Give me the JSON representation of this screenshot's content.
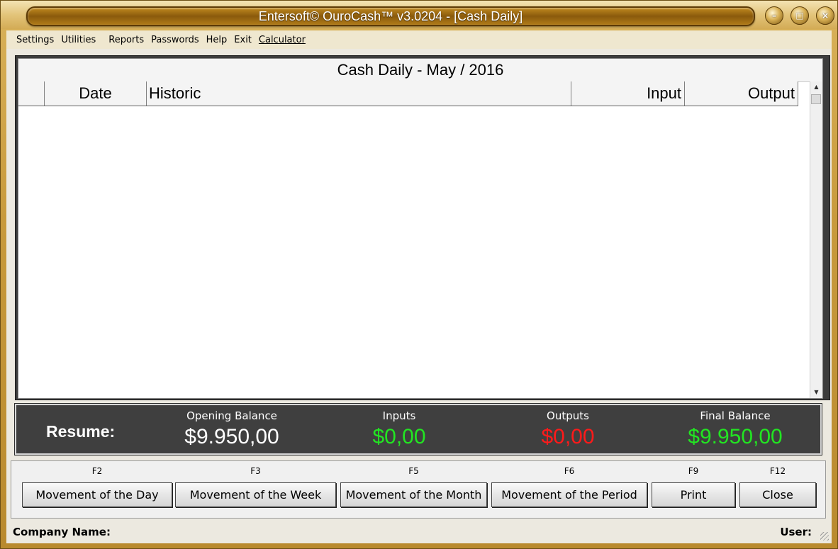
{
  "window": {
    "title": "Entersoft© OuroCash™ v3.0204 - [Cash Daily]"
  },
  "menu": {
    "items": [
      "Settings",
      "Utilities",
      "Reports",
      "Passwords",
      "Help",
      "Exit",
      "Calculator"
    ]
  },
  "grid": {
    "title": "Cash Daily - May / 2016",
    "columns": [
      "Date",
      "Historic",
      "Input",
      "Output"
    ],
    "rows": []
  },
  "resume": {
    "label": "Resume:",
    "opening_balance": {
      "label": "Opening Balance",
      "value": "$9.950,00",
      "color": "#ffffff"
    },
    "inputs": {
      "label": "Inputs",
      "value": "$0,00",
      "color": "#22e522"
    },
    "outputs": {
      "label": "Outputs",
      "value": "$0,00",
      "color": "#ff1a1a"
    },
    "final_balance": {
      "label": "Final Balance",
      "value": "$9.950,00",
      "color": "#22e522"
    }
  },
  "buttons": [
    {
      "key": "F2",
      "label": "Movement of the Day"
    },
    {
      "key": "F3",
      "label": "Movement of the Week"
    },
    {
      "key": "F5",
      "label": "Movement of the Month"
    },
    {
      "key": "F6",
      "label": "Movement of the Period"
    },
    {
      "key": "F9",
      "label": "Print"
    },
    {
      "key": "F12",
      "label": "Close"
    }
  ],
  "status": {
    "company_label": "Company Name:",
    "user_label": "User:"
  },
  "icons": {
    "minimize": "minimize-icon",
    "maximize": "maximize-icon",
    "close": "close-icon"
  }
}
